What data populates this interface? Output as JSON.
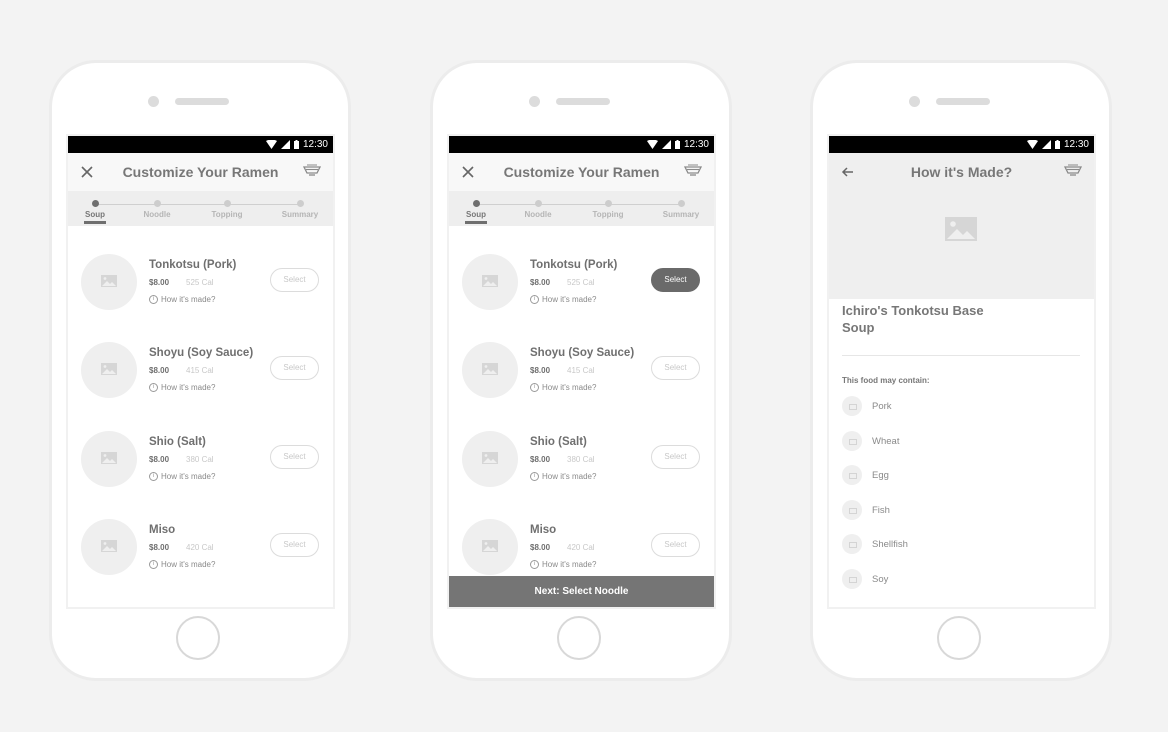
{
  "status_bar": {
    "time": "12:30"
  },
  "screens": [
    {
      "title": "Customize Your Ramen",
      "steps": [
        {
          "label": "Soup",
          "active": true
        },
        {
          "label": "Noodle",
          "active": false
        },
        {
          "label": "Topping",
          "active": false
        },
        {
          "label": "Summary",
          "active": false
        }
      ],
      "items": [
        {
          "name": "Tonkotsu (Pork)",
          "price": "$8.00",
          "calories": "525 Cal",
          "how": "How it's made?",
          "select": "Select",
          "selected": false
        },
        {
          "name": "Shoyu (Soy Sauce)",
          "price": "$8.00",
          "calories": "415 Cal",
          "how": "How it's made?",
          "select": "Select",
          "selected": false
        },
        {
          "name": "Shio (Salt)",
          "price": "$8.00",
          "calories": "380 Cal",
          "how": "How it's made?",
          "select": "Select",
          "selected": false
        },
        {
          "name": "Miso",
          "price": "$8.00",
          "calories": "420 Cal",
          "how": "How it's made?",
          "select": "Select",
          "selected": false
        }
      ]
    },
    {
      "title": "Customize Your Ramen",
      "steps": [
        {
          "label": "Soup",
          "active": true
        },
        {
          "label": "Noodle",
          "active": false
        },
        {
          "label": "Topping",
          "active": false
        },
        {
          "label": "Summary",
          "active": false
        }
      ],
      "items": [
        {
          "name": "Tonkotsu (Pork)",
          "price": "$8.00",
          "calories": "525 Cal",
          "how": "How it's made?",
          "select": "Select",
          "selected": true
        },
        {
          "name": "Shoyu (Soy Sauce)",
          "price": "$8.00",
          "calories": "415 Cal",
          "how": "How it's made?",
          "select": "Select",
          "selected": false
        },
        {
          "name": "Shio (Salt)",
          "price": "$8.00",
          "calories": "380 Cal",
          "how": "How it's made?",
          "select": "Select",
          "selected": false
        },
        {
          "name": "Miso",
          "price": "$8.00",
          "calories": "420 Cal",
          "how": "How it's made?",
          "select": "Select",
          "selected": false
        }
      ],
      "next_button": "Next: Select Noodle"
    },
    {
      "title": "How it's Made?",
      "detail_title": "Ichiro's Tonkotsu Base Soup",
      "contains_label": "This food may contain:",
      "allergens": [
        "Pork",
        "Wheat",
        "Egg",
        "Fish",
        "Shellfish",
        "Soy"
      ]
    }
  ],
  "colors": {
    "selected_button": "#6a6a6a",
    "next_bar": "#757575",
    "background": "#f3f3f3"
  }
}
